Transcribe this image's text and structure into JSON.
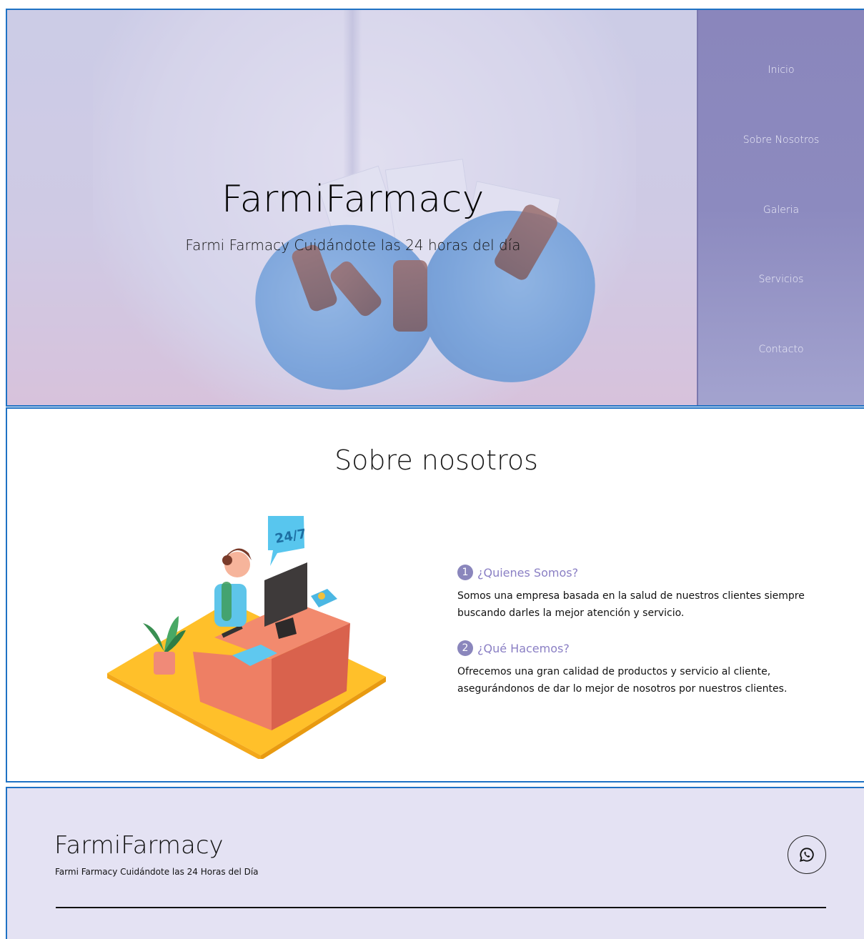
{
  "hero": {
    "title": "FarmiFarmacy",
    "subtitle": "Farmi Farmacy Cuidándote las 24 horas del día"
  },
  "nav": {
    "items": [
      {
        "label": "Inicio"
      },
      {
        "label": "Sobre Nosotros"
      },
      {
        "label": "Galeria"
      },
      {
        "label": "Servicios"
      },
      {
        "label": "Contacto"
      }
    ]
  },
  "about": {
    "title": "Sobre nosotros",
    "illustration_badge": "24/7",
    "items": [
      {
        "number": "1",
        "title": "¿Quienes Somos?",
        "text": "Somos una empresa basada en la salud de nuestros clientes siempre buscando darles la mejor atención y servicio."
      },
      {
        "number": "2",
        "title": "¿Qué Hacemos?",
        "text": "Ofrecemos una gran calidad de productos y servicio al cliente, asegurándonos de dar lo mejor de nosotros por nuestros clientes."
      }
    ]
  },
  "footer": {
    "title": "FarmiFarmacy",
    "subtitle": "Farmi Farmacy Cuidándote las 24 Horas del Día",
    "contact_icon": "whatsapp-icon"
  },
  "colors": {
    "accent": "#8a86bc",
    "frame": "#1f72c4",
    "footer_bg": "#e4e2f3",
    "item_title": "#8a7fc4"
  }
}
